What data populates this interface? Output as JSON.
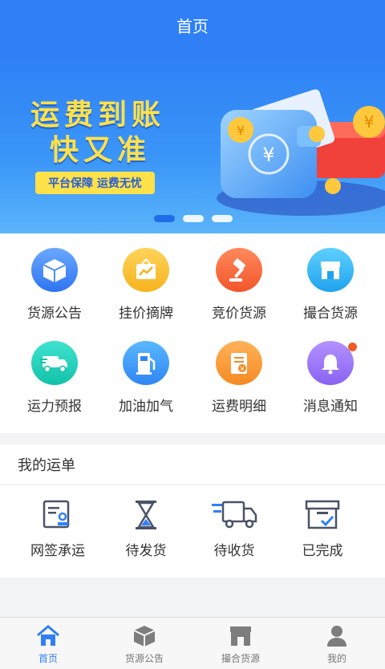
{
  "header": {
    "title": "首页"
  },
  "banner": {
    "headline_line1": "运费到账",
    "headline_line2": "快又准",
    "tag": "平台保障 运费无忧",
    "dots": 3,
    "active_dot": 0
  },
  "grid": {
    "items": [
      {
        "label": "货源公告",
        "icon": "box-icon"
      },
      {
        "label": "挂价摘牌",
        "icon": "price-board-icon"
      },
      {
        "label": "竞价货源",
        "icon": "gavel-icon"
      },
      {
        "label": "撮合货源",
        "icon": "store-icon"
      },
      {
        "label": "运力预报",
        "icon": "truck-icon"
      },
      {
        "label": "加油加气",
        "icon": "fuel-pump-icon"
      },
      {
        "label": "运费明细",
        "icon": "bill-icon"
      },
      {
        "label": "消息通知",
        "icon": "bell-icon"
      }
    ]
  },
  "orders": {
    "title": "我的运单",
    "items": [
      {
        "label": "网签承运",
        "icon": "contract-icon"
      },
      {
        "label": "待发货",
        "icon": "hourglass-icon"
      },
      {
        "label": "待收货",
        "icon": "delivery-truck-icon"
      },
      {
        "label": "已完成",
        "icon": "archive-check-icon"
      }
    ]
  },
  "tabbar": {
    "items": [
      {
        "label": "首页",
        "icon": "home-icon",
        "active": true
      },
      {
        "label": "货源公告",
        "icon": "box-icon",
        "active": false
      },
      {
        "label": "撮合货源",
        "icon": "store-icon",
        "active": false
      },
      {
        "label": "我的",
        "icon": "user-icon",
        "active": false
      }
    ]
  },
  "colors": {
    "primary": "#2f80f7",
    "banner_yellow": "#ffe14a",
    "notification_dot": "#f05a28"
  }
}
